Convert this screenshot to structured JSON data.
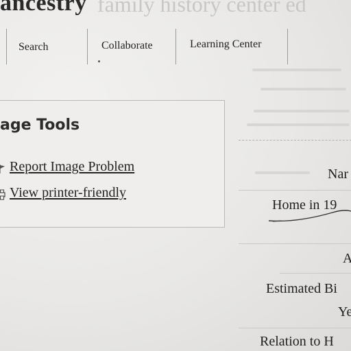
{
  "header": {
    "brand": "ancestry",
    "tagline": "family history center ed"
  },
  "nav": {
    "items": [
      {
        "label": "Search"
      },
      {
        "label": "Collaborate"
      },
      {
        "label": "Learning Center"
      }
    ]
  },
  "image_tools": {
    "title": "age Tools",
    "links": [
      {
        "label": "Report Image Problem",
        "icon": "flag-icon"
      },
      {
        "label": "View printer-friendly",
        "icon": "printer-icon"
      }
    ]
  },
  "record": {
    "name_label": "Nar",
    "home_label": "Home in 19",
    "age_label": "A",
    "birth_label": "Estimated Bi",
    "year_label": "Ye",
    "relation_label": "Relation to H"
  }
}
